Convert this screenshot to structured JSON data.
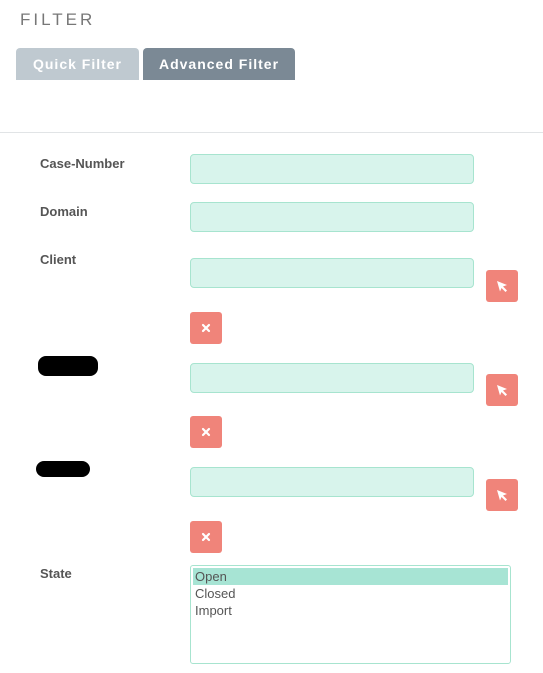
{
  "header": {
    "title": "FILTER"
  },
  "tabs": {
    "quick": "Quick Filter",
    "advanced": "Advanced Filter"
  },
  "fields": {
    "case_number": {
      "label": "Case-Number",
      "value": ""
    },
    "domain": {
      "label": "Domain",
      "value": ""
    },
    "client": {
      "label": "Client",
      "value": ""
    },
    "redacted_1": {
      "value": ""
    },
    "redacted_2": {
      "value": ""
    }
  },
  "state": {
    "label": "State",
    "options": [
      "Open",
      "Closed",
      "Import"
    ],
    "selected": "Open"
  },
  "icons": {
    "select": "cursor-arrow-icon",
    "clear": "x-icon"
  },
  "colors": {
    "accent_red": "#f0847a",
    "field_bg": "#d8f4ec",
    "tab_active": "#7b8995",
    "tab_inactive": "#bfc9d0"
  }
}
